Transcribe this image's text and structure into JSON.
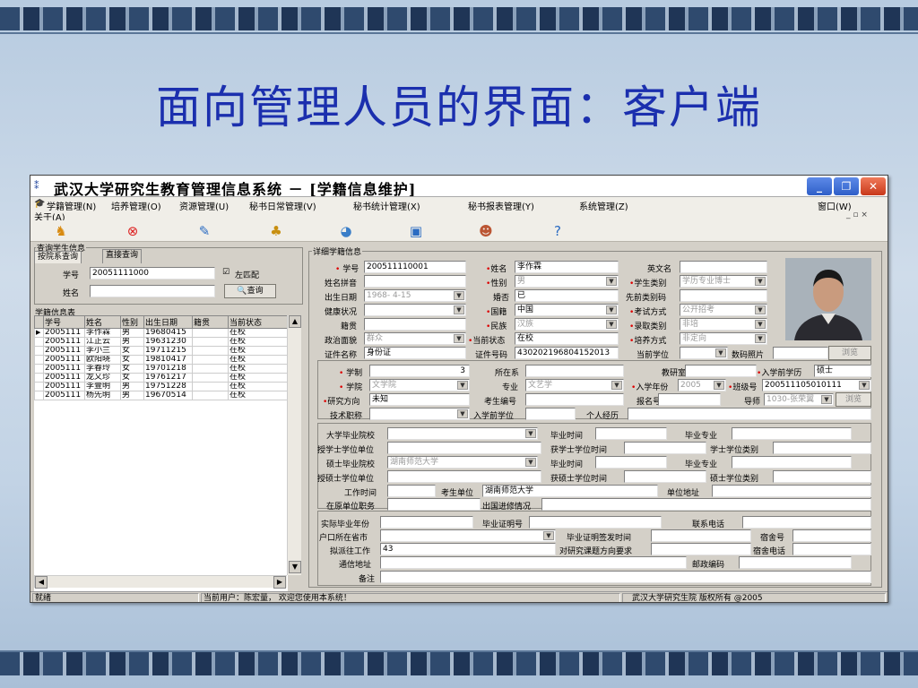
{
  "slide": {
    "title": "面向管理人员的界面：客户端"
  },
  "window": {
    "title": "武汉大学研究生教育管理信息系统 － [学籍信息维护]",
    "controls": {
      "minimize": "_",
      "maximize": "❐",
      "close": "✕"
    }
  },
  "menu": {
    "items": [
      "学籍管理(N)",
      "培养管理(O)",
      "资源管理(U)",
      "秘书日常管理(V)",
      "秘书统计管理(X)",
      "秘书报表管理(Y)",
      "系统管理(Z)",
      "窗口(W)"
    ],
    "second_row": "关于(A)",
    "mdi_controls": "_ ▫ ×"
  },
  "toolbar": {
    "icons": [
      "person-icon",
      "delete-icon",
      "edit-icon",
      "tree-icon",
      "chart-icon",
      "report-icon",
      "users-icon",
      "help-icon"
    ]
  },
  "left": {
    "query_group": "查询学生信息",
    "tab_byfaculty": "按院系查询",
    "tab_direct": "直接查询",
    "xuehao_label": "学号",
    "xuehao_value": "20051111000",
    "checkbox_label": "左匹配",
    "checkbox_checked": true,
    "name_label": "姓名",
    "name_value": "",
    "search_button": "查询",
    "table_group": "学籍信息表",
    "columns": [
      "学号",
      "姓名",
      "性别",
      "出生日期",
      "籍贯",
      "当前状态"
    ],
    "rows": [
      [
        "2005111",
        "李作霖",
        "男",
        "19680415",
        "",
        "在校"
      ],
      [
        "2005111",
        "江正云",
        "男",
        "19631230",
        "",
        "在校"
      ],
      [
        "2005111",
        "李小兰",
        "女",
        "19711215",
        "",
        "在校"
      ],
      [
        "2005111",
        "欧阳晓",
        "女",
        "19810417",
        "",
        "在校"
      ],
      [
        "2005111",
        "李春玲",
        "女",
        "19701218",
        "",
        "在校"
      ],
      [
        "2005111",
        "龙又珍",
        "女",
        "19761217",
        "",
        "在校"
      ],
      [
        "2005111",
        "李壹明",
        "男",
        "19751228",
        "",
        "在校"
      ],
      [
        "2005111",
        "杨先明",
        "男",
        "19670514",
        "",
        "在校"
      ]
    ]
  },
  "detail": {
    "group": "详细学籍信息",
    "xuehao_label": "学号",
    "xuehao": "200511110001",
    "name_label": "姓名",
    "name": "李作霖",
    "english_label": "英文名",
    "english": "",
    "pinyin_label": "姓名拼音",
    "pinyin": "",
    "gender_label": "性别",
    "gender": "男",
    "stutype_label": "学生类别",
    "stutype": "学历专业博士",
    "birth_label": "出生日期",
    "birth": "1968- 4-15",
    "marriage_label": "婚否",
    "marriage": "已",
    "prevnum_label": "先前类别码",
    "prevnum": "",
    "health_label": "健康状况",
    "health": "",
    "nation_label": "国籍",
    "nation": "中国",
    "exam_label": "考试方式",
    "exam": "公开招考",
    "origin_label": "籍贯",
    "origin": "",
    "ethnic_label": "民族",
    "ethnic": "汉族",
    "enroll_label": "录取类别",
    "enroll": "非培",
    "politics_label": "政治面貌",
    "politics": "群众",
    "status_label": "当前状态",
    "status": "在校",
    "train_label": "培养方式",
    "train": "非定向",
    "idname_label": "证件名称",
    "idname": "身份证",
    "idnum_label": "证件号码",
    "idnum": "430202196804152013",
    "degree_label": "当前学位",
    "degree": "",
    "photo_label": "数码照片",
    "photo_btn": "浏览",
    "xuezhi_label": "学制",
    "xuezhi": "3",
    "dept_label": "所在系",
    "dept": "",
    "jys_label": "教研室",
    "jys": "",
    "entrydeg_label": "入学前学历",
    "entrydeg": "硕士",
    "college_label": "学院",
    "college": "文学院",
    "major_label": "专业",
    "major": "文艺学",
    "entryyear_label": "入学年份",
    "entryyear": "2005",
    "class_label": "班级号",
    "class": "200511105010111",
    "research_label": "研究方向",
    "research": "未知",
    "examno_label": "考生编号",
    "examno": "",
    "regno_label": "报名号",
    "regno": "",
    "tutor_label": "导师",
    "tutor": "1030-张荣翼",
    "tutor_btn": "浏览",
    "title_label": "技术职称",
    "title": "",
    "entrydegree_label": "入学前学位",
    "entrydegree": "",
    "resume_label": "个人经历",
    "resume": "",
    "ug_school_label": "大学毕业院校",
    "ug_time_label": "毕业时间",
    "ug_major_label": "毕业专业",
    "ba_unit_label": "授学士学位单位",
    "ba_time_label": "获学士学位时间",
    "ba_type_label": "学士学位类别",
    "ms_school_label": "硕士毕业院校",
    "ms_school": "湖南师范大学",
    "ms_time_label": "毕业时间",
    "ms_major_label": "毕业专业",
    "ms_unit_label": "授硕士学位单位",
    "ms_deg_time_label": "获硕士学位时间",
    "ms_type_label": "硕士学位类别",
    "worktime_label": "工作时间",
    "examunit_label": "考生单位",
    "examunit": "湖南师范大学",
    "unitaddr_label": "单位地址",
    "orig_title_label": "在原单位职务",
    "study_label": "出国进修情况",
    "actual_grad_label": "实际毕业年份",
    "cert_label": "毕业证明号",
    "phone_label": "联系电话",
    "hukou_label": "户口所在省市",
    "cert_time_label": "毕业证明签发时间",
    "dorm_label": "宿舍号",
    "plan_label": "拟派往工作",
    "plan": "43",
    "req_label": "对研究课题方向要求",
    "dormphone_label": "宿舍电话",
    "addr_label": "通信地址",
    "zip_label": "邮政编码",
    "remark_label": "备注"
  },
  "status": {
    "ready": "就绪",
    "user": "当前用户：陈宏量，  欢迎您使用本系统！",
    "copyright": "武汉大学研究生院   版权所有 @2005"
  },
  "colors": {
    "title": "#1b2fae",
    "required": "#dd0000",
    "window_bg": "#d4d0c8"
  }
}
